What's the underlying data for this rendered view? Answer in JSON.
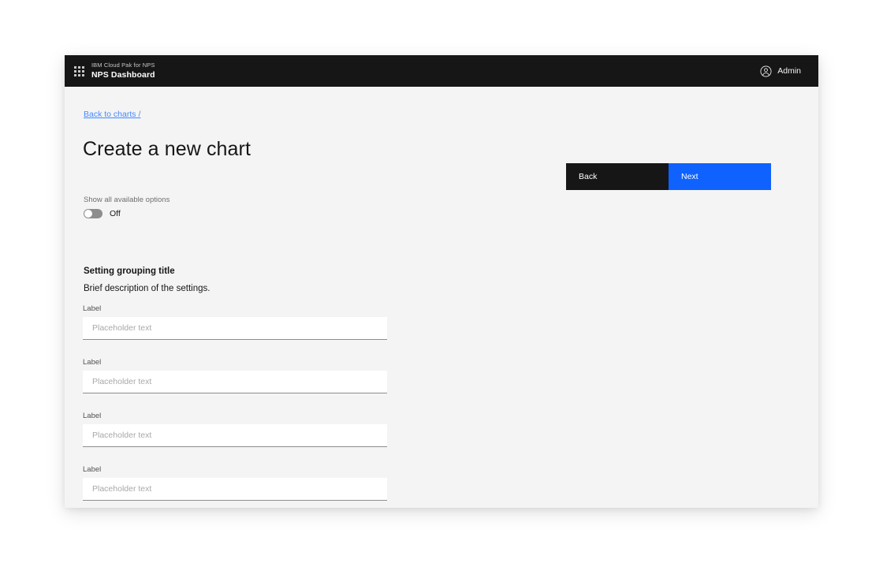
{
  "header": {
    "grid_icon": "app-switcher-grid-icon",
    "product_name": "IBM Cloud Pak for NPS",
    "app_name": "NPS Dashboard",
    "user_icon": "user-avatar-icon",
    "user_name": "Admin"
  },
  "page": {
    "breadcrumb": "Back to charts /",
    "title": "Create a new chart"
  },
  "toggle": {
    "caption": "Show all available options",
    "state_label": "Off",
    "checked": false
  },
  "settings_group": {
    "title": "Setting grouping title",
    "description": "Brief description of the settings."
  },
  "fields": [
    {
      "label": "Label",
      "value": "",
      "placeholder": "Placeholder text"
    },
    {
      "label": "Label",
      "value": "",
      "placeholder": "Placeholder text"
    },
    {
      "label": "Label",
      "value": "",
      "placeholder": "Placeholder text"
    },
    {
      "label": "Label",
      "value": "",
      "placeholder": "Placeholder text"
    }
  ],
  "actions": {
    "back_label": "Back",
    "next_label": "Next"
  },
  "colors": {
    "header_bg": "#161616",
    "page_bg": "#f4f4f4",
    "accent_blue": "#0f62fe",
    "link_blue": "#4589ff",
    "toggle_track": "#8d8d8d",
    "input_bg": "#ffffff",
    "input_border": "#8d8d8d"
  }
}
